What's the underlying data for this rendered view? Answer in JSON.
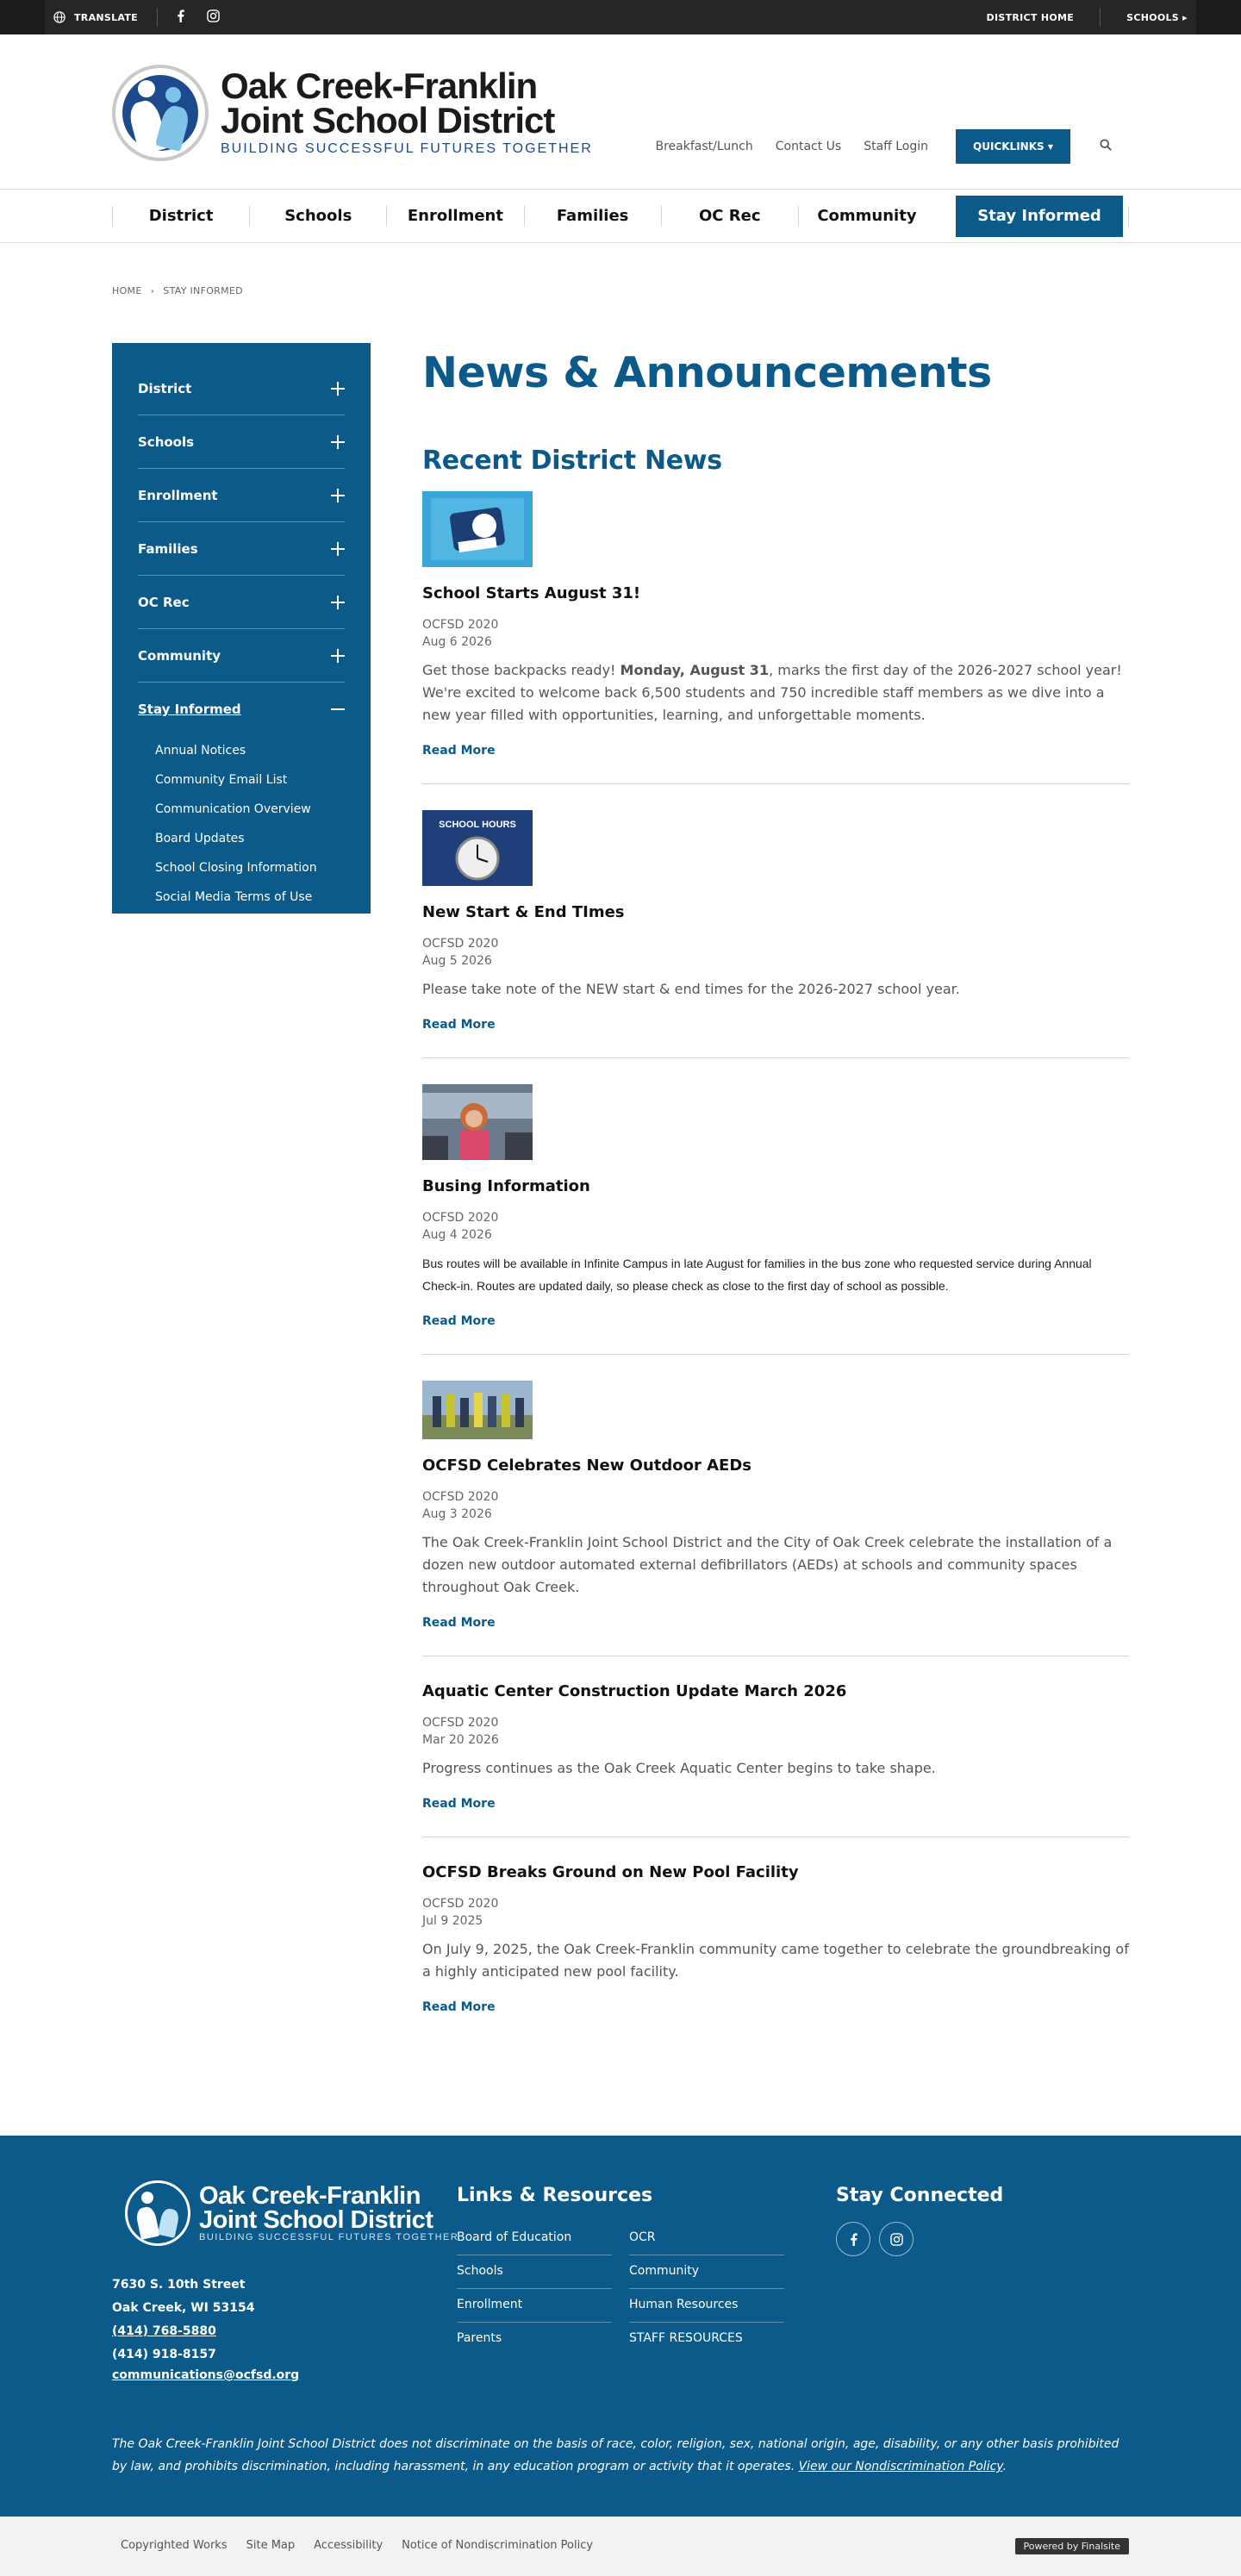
{
  "utility": {
    "translate": "TRANSLATE",
    "district_home": "DISTRICT HOME",
    "schools": "SCHOOLS"
  },
  "logo": {
    "line1": "Oak Creek-Franklin",
    "line2": "Joint School District",
    "tagline": "BUILDING SUCCESSFUL FUTURES TOGETHER"
  },
  "header_links": [
    "Breakfast/Lunch",
    "Contact Us",
    "Staff Login"
  ],
  "quicklinks": "QUICKLINKS",
  "nav": [
    "District",
    "Schools",
    "Enrollment",
    "Families",
    "OC Rec",
    "Community",
    "Stay Informed"
  ],
  "breadcrumb": {
    "home": "HOME",
    "current": "STAY INFORMED"
  },
  "sidebar": {
    "items": [
      "District",
      "Schools",
      "Enrollment",
      "Families",
      "OC Rec",
      "Community"
    ],
    "open_item": "Stay Informed",
    "subitems": [
      "Annual Notices",
      "Community Email List",
      "Communication Overview",
      "Board Updates",
      "School Closing Information",
      "Social Media Terms of Use"
    ]
  },
  "page_title": "News & Announcements",
  "section_title": "Recent District News",
  "read_more": "Read More",
  "news": [
    {
      "title": "School Starts August 31!",
      "author": "OCFSD 2020",
      "date": "Aug 6 2026",
      "summary_pre": "Get those backpacks ready! ",
      "summary_bold": "Monday, August 31",
      "summary_post": ", marks the first day of the 2026-2027 school year! We're excited to welcome back 6,500 students and 750 incredible staff members as we dive into a new year filled with opportunities, learning, and unforgettable moments."
    },
    {
      "title": "New Start & End TImes",
      "author": "OCFSD 2020",
      "date": "Aug 5 2026",
      "thumb_text": "SCHOOL HOURS",
      "summary": "Please take note of the NEW start & end times for the 2026-2027 school year."
    },
    {
      "title": "Busing Information",
      "author": "OCFSD 2020",
      "date": "Aug 4 2026",
      "summary": "Bus routes will be available in Infinite Campus in late August for families in the bus zone who requested service during Annual Check-in. Routes are updated daily, so please check as close to the first day of school as possible."
    },
    {
      "title": "OCFSD Celebrates New Outdoor AEDs",
      "author": "OCFSD 2020",
      "date": "Aug 3 2026",
      "summary": "The Oak Creek-Franklin Joint School District and the City of Oak Creek celebrate the installation of a dozen new outdoor automated external defibrillators (AEDs) at schools and community spaces throughout Oak Creek."
    },
    {
      "title": "Aquatic Center Construction Update March 2026",
      "author": "OCFSD 2020",
      "date": "Mar 20 2026",
      "summary": "Progress continues as the Oak Creek Aquatic Center begins to take shape."
    },
    {
      "title": "OCFSD Breaks Ground on New Pool Facility",
      "author": "OCFSD 2020",
      "date": "Jul 9 2025",
      "summary": "On July 9, 2025, the Oak Creek-Franklin community came together to celebrate the groundbreaking of a highly anticipated new pool facility."
    }
  ],
  "footer": {
    "address1": "7630 S. 10th Street",
    "address2": "Oak Creek, WI  53154",
    "phone1": "(414) 768-5880",
    "phone2": "(414) 918-8157",
    "email": "communications@ocfsd.org",
    "links_title": "Links & Resources",
    "links": [
      "Board of Education",
      "OCR",
      "Schools",
      "Community",
      "Enrollment",
      "Human Resources",
      "Parents",
      "STAFF RESOURCES"
    ],
    "connect_title": "Stay Connected",
    "disclaimer": "The Oak Creek-Franklin Joint School District does not discriminate on the basis of race, color, religion, sex, national origin, age, disability, or any other basis prohibited by law, and prohibits discrimination, including harassment, in any education program or activity that it operates. ",
    "disclaimer_link": "View our Nondiscrimination Policy"
  },
  "bottom_links": [
    "Copyrighted Works",
    "Site Map",
    "Accessibility",
    "Notice of Nondiscrimination Policy"
  ],
  "powered_by": "Powered by Finalsite",
  "colors": {
    "brand": "#0b5a8a",
    "utility_bar": "#262626"
  }
}
